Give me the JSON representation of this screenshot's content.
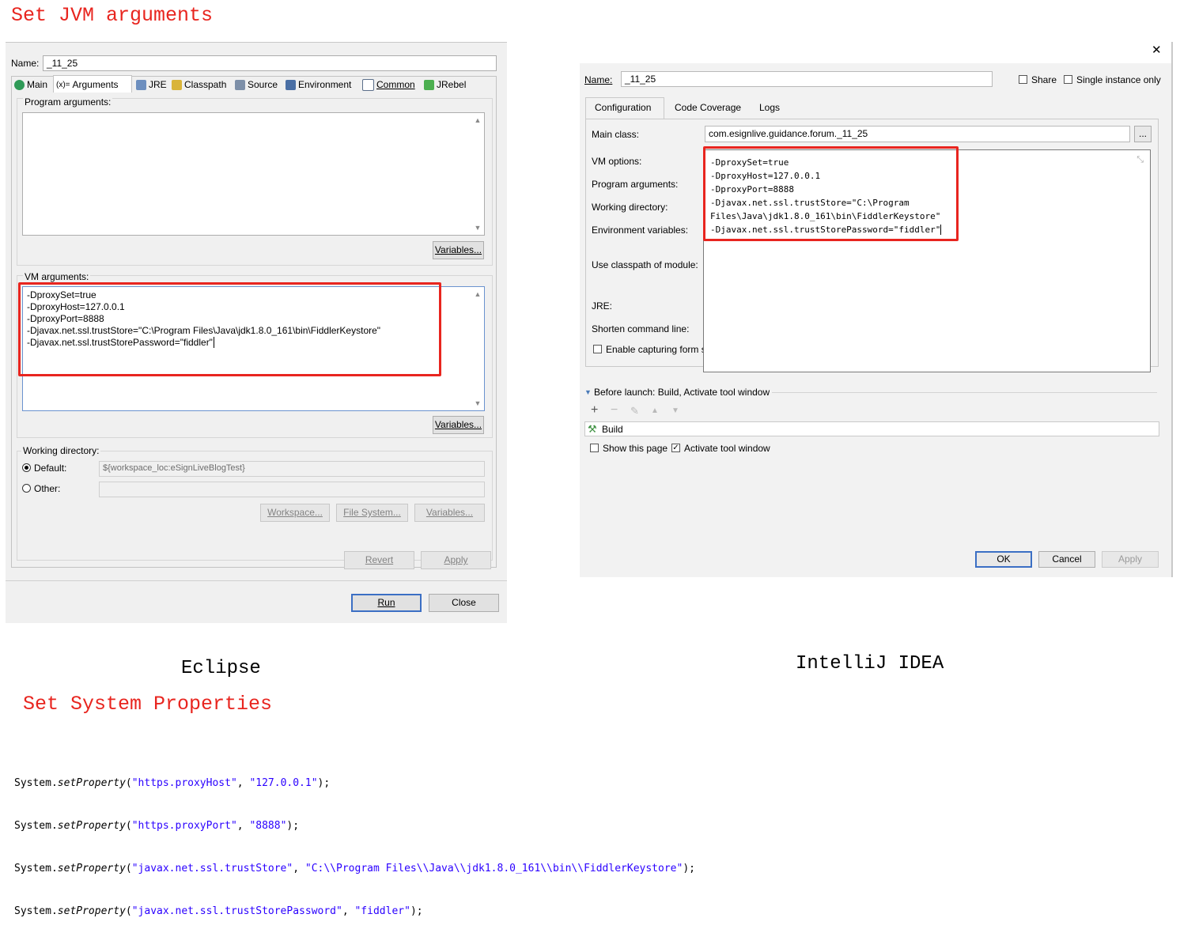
{
  "headings": {
    "set_jvm": "Set JVM arguments",
    "eclipse_caption": "Eclipse",
    "idea_caption": "IntelliJ IDEA",
    "set_sys_props": "Set System Properties"
  },
  "eclipse": {
    "name_label": "Name:",
    "name_value": "_11_25",
    "tabs": [
      "Main",
      "Arguments",
      "JRE",
      "Classpath",
      "Source",
      "Environment",
      "Common",
      "JRebel"
    ],
    "program_args_label": "Program arguments:",
    "variables_label": "Variables...",
    "vm_args_label": "VM arguments:",
    "vm_args": [
      "-DproxySet=true",
      "-DproxyHost=127.0.0.1",
      "-DproxyPort=8888",
      "-Djavax.net.ssl.trustStore=\"C:\\Program Files\\Java\\jdk1.8.0_161\\bin\\FiddlerKeystore\"",
      "-Djavax.net.ssl.trustStorePassword=\"fiddler\""
    ],
    "working_dir_label": "Working directory:",
    "default_label": "Default:",
    "default_value": "${workspace_loc:eSignLiveBlogTest}",
    "other_label": "Other:",
    "workspace_btn": "Workspace...",
    "filesystem_btn": "File System...",
    "variables_btn2": "Variables...",
    "revert_btn": "Revert",
    "apply_btn": "Apply",
    "run_btn": "Run",
    "close_btn": "Close"
  },
  "idea": {
    "close_glyph": "✕",
    "name_label": "Name:",
    "name_value": "_11_25",
    "share_label": "Share",
    "single_instance_label": "Single instance only",
    "tabs": [
      "Configuration",
      "Code Coverage",
      "Logs"
    ],
    "main_class_label": "Main class:",
    "main_class_value": "com.esignlive.guidance.forum._11_25",
    "browse_btn": "...",
    "vm_options_label": "VM options:",
    "program_args_label": "Program arguments:",
    "working_dir_label": "Working directory:",
    "env_vars_label": "Environment variables:",
    "classpath_label": "Use classpath of module:",
    "jre_label": "JRE:",
    "shorten_label": "Shorten command line:",
    "enable_capture_label": "Enable capturing form s",
    "vm_options": [
      "-DproxySet=true",
      "-DproxyHost=127.0.0.1",
      "-DproxyPort=8888",
      "-Djavax.net.ssl.trustStore=\"C:\\Program",
      "Files\\Java\\jdk1.8.0_161\\bin\\FiddlerKeystore\"",
      "-Djavax.net.ssl.trustStorePassword=\"fiddler\""
    ],
    "before_launch_label": "Before launch: Build, Activate tool window",
    "build_label": "Build",
    "show_page_label": "Show this page",
    "activate_label": "Activate tool window",
    "ok_btn": "OK",
    "cancel_btn": "Cancel",
    "apply_btn": "Apply"
  },
  "code_lines": [
    {
      "obj": "System.",
      "method": "setProperty",
      "open": "(",
      "a": "\"https.proxyHost\"",
      "sep": ", ",
      "b": "\"127.0.0.1\"",
      "close": ");"
    },
    {
      "obj": "System.",
      "method": "setProperty",
      "open": "(",
      "a": "\"https.proxyPort\"",
      "sep": ", ",
      "b": "\"8888\"",
      "close": ");"
    },
    {
      "obj": "System.",
      "method": "setProperty",
      "open": "(",
      "a": "\"javax.net.ssl.trustStore\"",
      "sep": ", ",
      "b": "\"C:\\\\Program Files\\\\Java\\\\jdk1.8.0_161\\\\bin\\\\FiddlerKeystore\"",
      "close": ");"
    },
    {
      "obj": "System.",
      "method": "setProperty",
      "open": "(",
      "a": "\"javax.net.ssl.trustStorePassword\"",
      "sep": ", ",
      "b": "\"fiddler\"",
      "close": ");"
    }
  ],
  "colors": {
    "highlight_red": "#e8251f",
    "string_blue": "#2a00ff",
    "default_button_blue": "#3b6fc4"
  }
}
